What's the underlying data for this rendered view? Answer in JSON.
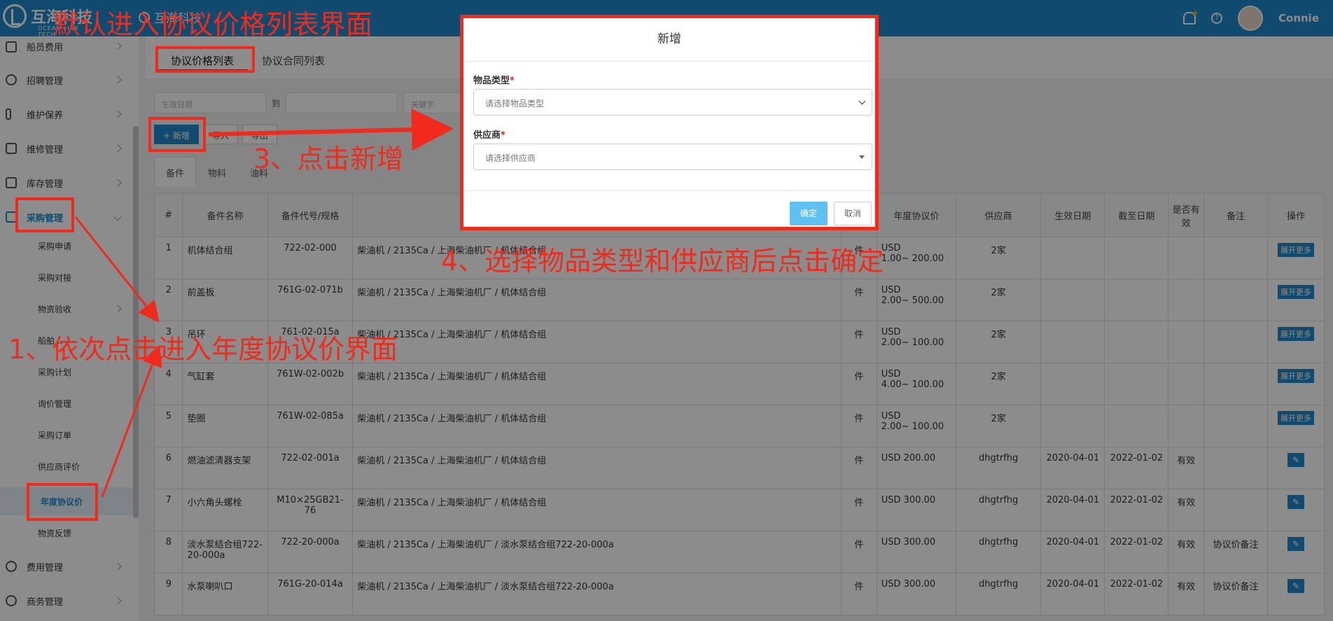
{
  "header": {
    "logo_text": "互海科技",
    "logo_sub": "OCEAN LINK TECH",
    "home_label": "互海科技",
    "username": "Connie"
  },
  "sidebar": {
    "items": [
      {
        "label": "船员费用"
      },
      {
        "label": "招聘管理"
      },
      {
        "label": "维护保养"
      },
      {
        "label": "维修管理"
      },
      {
        "label": "库存管理"
      },
      {
        "label": "采购管理"
      },
      {
        "label": "费用管理"
      },
      {
        "label": "商务管理"
      }
    ],
    "sub_items": [
      {
        "label": "采购申请"
      },
      {
        "label": "采购对接"
      },
      {
        "label": "物资验收"
      },
      {
        "label": "船舶..."
      },
      {
        "label": "采购计划"
      },
      {
        "label": "询价管理"
      },
      {
        "label": "采购订单"
      },
      {
        "label": "供应商评价"
      },
      {
        "label": "年度协议价"
      },
      {
        "label": "物资反馈"
      }
    ]
  },
  "page_tabs": [
    {
      "label": "协议价格列表"
    },
    {
      "label": "协议合同列表"
    }
  ],
  "filters": {
    "date_placeholder": "生效日期",
    "to_label": "到",
    "keyword_placeholder": "关键字"
  },
  "toolbar": {
    "add_label": "+ 新增",
    "import_label": "导入",
    "export_label": "导出"
  },
  "category_tabs": [
    {
      "label": "备件"
    },
    {
      "label": "物料"
    },
    {
      "label": "油料"
    }
  ],
  "table": {
    "headers": [
      "#",
      "备件名称",
      "备件代号/规格",
      "",
      "",
      "年度协议价",
      "供应商",
      "生效日期",
      "截至日期",
      "是否有效",
      "备注",
      "操作"
    ],
    "rows": [
      {
        "n": "1",
        "name": "机体结合组",
        "code": "722-02-000",
        "path": "柴油机 / 2135Ca / 上海柴油机厂 / 机体结合组",
        "unit": "件",
        "price": "USD",
        "price2": "1.00~ 200.00",
        "supplier": "2家",
        "start": "",
        "end": "",
        "valid": "",
        "note": "",
        "op": "展开更多"
      },
      {
        "n": "2",
        "name": "前盖板",
        "code": "761G-02-071b",
        "path": "柴油机 / 2135Ca / 上海柴油机厂 / 机体结合组",
        "unit": "件",
        "price": "USD",
        "price2": "2.00~ 500.00",
        "supplier": "2家",
        "start": "",
        "end": "",
        "valid": "",
        "note": "",
        "op": "展开更多"
      },
      {
        "n": "3",
        "name": "吊环",
        "code": "761-02-015a",
        "path": "柴油机 / 2135Ca / 上海柴油机厂 / 机体结合组",
        "unit": "件",
        "price": "USD",
        "price2": "2.00~ 100.00",
        "supplier": "2家",
        "start": "",
        "end": "",
        "valid": "",
        "note": "",
        "op": "展开更多"
      },
      {
        "n": "4",
        "name": "气缸套",
        "code": "761W-02-002b",
        "path": "柴油机 / 2135Ca / 上海柴油机厂 / 机体结合组",
        "unit": "件",
        "price": "USD",
        "price2": "4.00~ 100.00",
        "supplier": "2家",
        "start": "",
        "end": "",
        "valid": "",
        "note": "",
        "op": "展开更多"
      },
      {
        "n": "5",
        "name": "垫圈",
        "code": "761W-02-085a",
        "path": "柴油机 / 2135Ca / 上海柴油机厂 / 机体结合组",
        "unit": "件",
        "price": "USD",
        "price2": "2.00~ 100.00",
        "supplier": "2家",
        "start": "",
        "end": "",
        "valid": "",
        "note": "",
        "op": "展开更多"
      },
      {
        "n": "6",
        "name": "燃油滤清器支架",
        "code": "722-02-001a",
        "path": "柴油机 / 2135Ca / 上海柴油机厂 / 机体结合组",
        "unit": "件",
        "price": "USD 200.00",
        "price2": "",
        "supplier": "dhgtrfhg",
        "start": "2020-04-01",
        "end": "2022-01-02",
        "valid": "有效",
        "note": "",
        "op": "✎"
      },
      {
        "n": "7",
        "name": "小六角头螺栓",
        "code": "M10×25GB21-76",
        "path": "柴油机 / 2135Ca / 上海柴油机厂 / 机体结合组",
        "unit": "件",
        "price": "USD 300.00",
        "price2": "",
        "supplier": "dhgtrfhg",
        "start": "2020-04-01",
        "end": "2022-01-02",
        "valid": "有效",
        "note": "",
        "op": "✎"
      },
      {
        "n": "8",
        "name": "淡水泵结合组722-20-000a",
        "code": "722-20-000a",
        "path": "柴油机 / 2135Ca / 上海柴油机厂 / 淡水泵结合组722-20-000a",
        "unit": "件",
        "price": "USD 300.00",
        "price2": "",
        "supplier": "dhgtrfhg",
        "start": "2020-04-01",
        "end": "2022-01-02",
        "valid": "有效",
        "note": "协议价备注",
        "op": "✎"
      },
      {
        "n": "9",
        "name": "水泵喇叭口",
        "code": "761G-20-014a",
        "path": "柴油机 / 2135Ca / 上海柴油机厂 / 淡水泵结合组722-20-000a",
        "unit": "件",
        "price": "USD 300.00",
        "price2": "",
        "supplier": "dhgtrfhg",
        "start": "2020-04-01",
        "end": "2022-01-02",
        "valid": "有效",
        "note": "协议价备注",
        "op": "✎"
      }
    ]
  },
  "modal": {
    "title": "新增",
    "type_label": "物品类型",
    "type_placeholder": "请选择物品类型",
    "supplier_label": "供应商",
    "supplier_placeholder": "请选择供应商",
    "required_mark": "*",
    "ok_label": "确定",
    "cancel_label": "取消"
  },
  "annotations": {
    "step0": "默认进入协议价格列表界面",
    "step1": "1、依次点击进入年度协议价界面",
    "step3": "3、点击新增",
    "step4": "4、选择物品类型和供应商后点击确定",
    "color": "#f02b1d"
  }
}
